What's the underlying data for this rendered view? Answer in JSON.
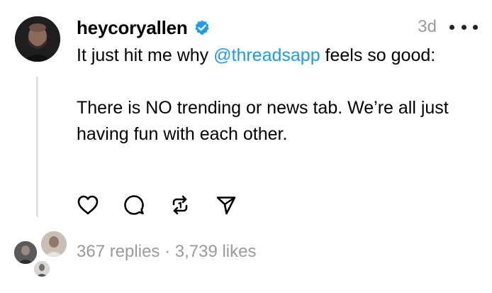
{
  "post": {
    "username": "heycoryallen",
    "timestamp": "3d",
    "text": {
      "line1_before": "It just hit me why ",
      "mention": "@threadsapp",
      "line1_after": " feels so good:",
      "paragraph2": "There is NO trending or news tab. We’re all just having fun with each other."
    },
    "stats": {
      "replies": "367 replies",
      "separator": " · ",
      "likes": "3,739 likes"
    }
  },
  "icons": {
    "verified": "verified-badge-icon",
    "more": "more-options-icon",
    "like": "heart-icon",
    "reply": "comment-icon",
    "repost": "repost-icon",
    "share": "send-icon"
  },
  "colors": {
    "mention": "#1d9bf0",
    "verified": "#1d9bf0",
    "muted": "#9a9a9a",
    "thread_line": "#e0e0e0"
  }
}
